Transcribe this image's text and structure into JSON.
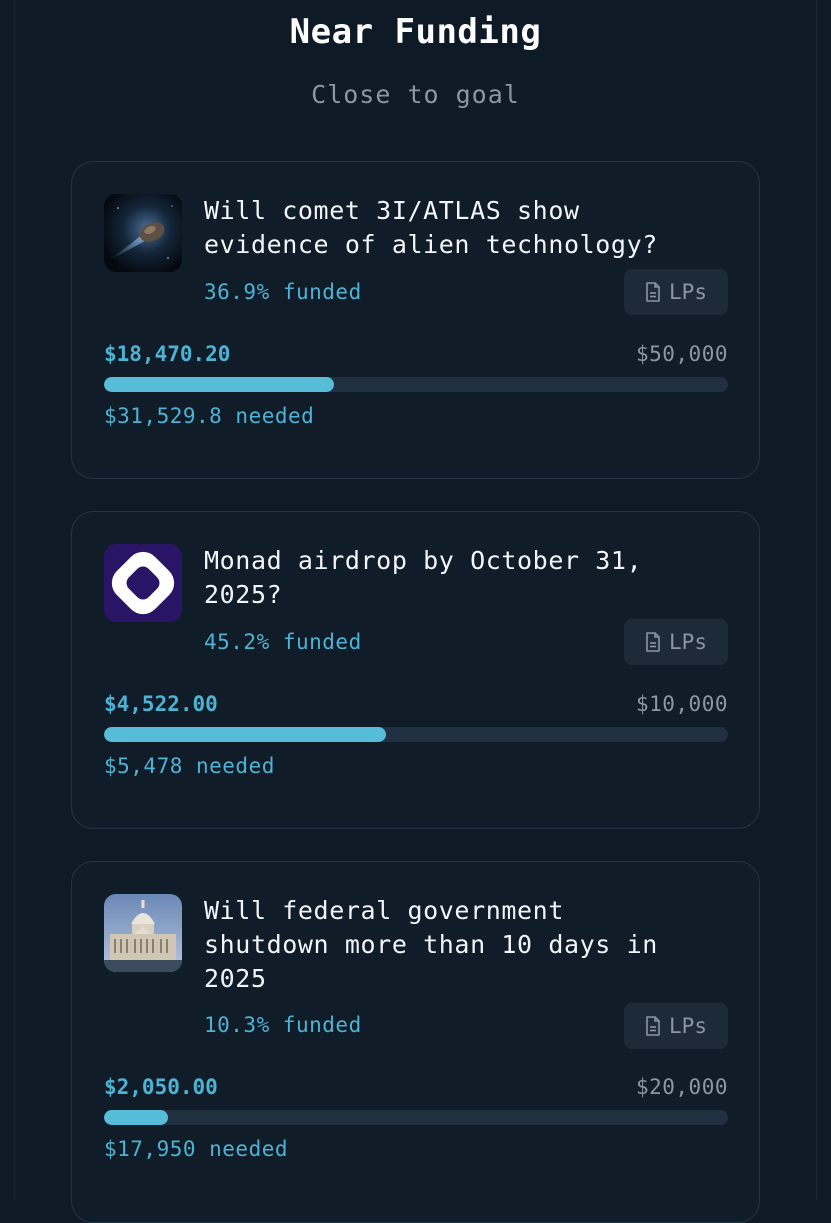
{
  "header": {
    "title": "Near Funding",
    "subtitle": "Close to goal"
  },
  "colors": {
    "background": "#0f1a27",
    "card": "#111c29",
    "accent": "#4db3d4",
    "bar_fill": "#56bcd8",
    "bar_track": "#213040"
  },
  "cards": [
    {
      "title": "Will comet 3I/ATLAS show evidence of alien technology?",
      "funded": "36.9% funded",
      "lps_label": "LPs",
      "raised": "$18,470.20",
      "goal": "$50,000",
      "progress": 0.369,
      "needed": "$31,529.8 needed",
      "icon": "comet-image"
    },
    {
      "title": "Monad airdrop by October 31, 2025?",
      "funded": "45.2% funded",
      "lps_label": "LPs",
      "raised": "$4,522.00",
      "goal": "$10,000",
      "progress": 0.452,
      "needed": "$5,478 needed",
      "icon": "monad-logo"
    },
    {
      "title": "Will federal government shutdown more than 10 days in 2025",
      "funded": "10.3% funded",
      "lps_label": "LPs",
      "raised": "$2,050.00",
      "goal": "$20,000",
      "progress": 0.103,
      "needed": "$17,950 needed",
      "icon": "capitol-image"
    }
  ]
}
